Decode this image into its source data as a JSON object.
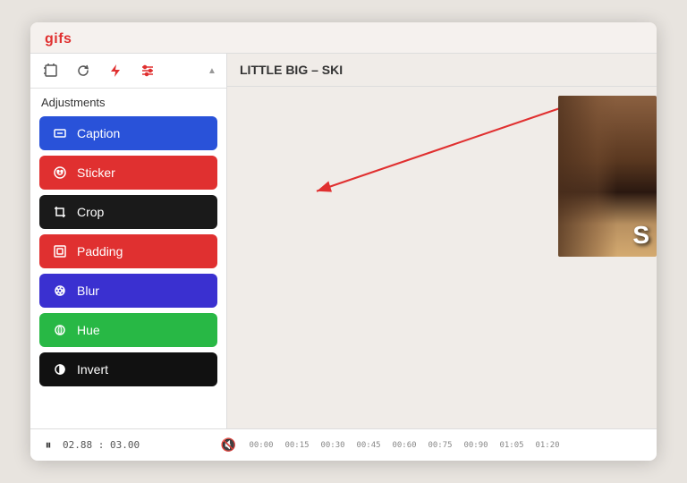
{
  "app": {
    "title": "gifs"
  },
  "toolbar": {
    "icons": [
      {
        "name": "crop-frame-icon",
        "symbol": "⊡",
        "active": false
      },
      {
        "name": "refresh-icon",
        "symbol": "↺",
        "active": false
      },
      {
        "name": "flash-icon",
        "symbol": "⚡",
        "active": false
      },
      {
        "name": "adjustments-icon",
        "symbol": "⚙",
        "active": true
      }
    ]
  },
  "adjustments": {
    "label": "Adjustments",
    "items": [
      {
        "id": "caption",
        "label": "Caption",
        "color": "blue",
        "icon": "T"
      },
      {
        "id": "sticker",
        "label": "Sticker",
        "color": "red",
        "icon": "◎"
      },
      {
        "id": "crop",
        "label": "Crop",
        "color": "black",
        "icon": "⤡"
      },
      {
        "id": "padding",
        "label": "Padding",
        "color": "red",
        "icon": "▣"
      },
      {
        "id": "blur",
        "label": "Blur",
        "color": "purple",
        "icon": "◈"
      },
      {
        "id": "hue",
        "label": "Hue",
        "color": "green",
        "icon": "◉"
      },
      {
        "id": "invert",
        "label": "Invert",
        "color": "black2",
        "icon": "◑"
      }
    ]
  },
  "video": {
    "title": "LITTLE BIG – SKI",
    "thumbnail_letter": "S"
  },
  "timeline": {
    "play_icon": "⏸",
    "time_current": "02.88",
    "time_total": "03.00",
    "speaker_icon": "🔇",
    "marks": [
      "00:00",
      "00:15",
      "00:30",
      "00:45",
      "00:60",
      "00:75",
      "00:90",
      "01:05",
      "01:20"
    ]
  },
  "arrow": {
    "color": "#e03030"
  }
}
